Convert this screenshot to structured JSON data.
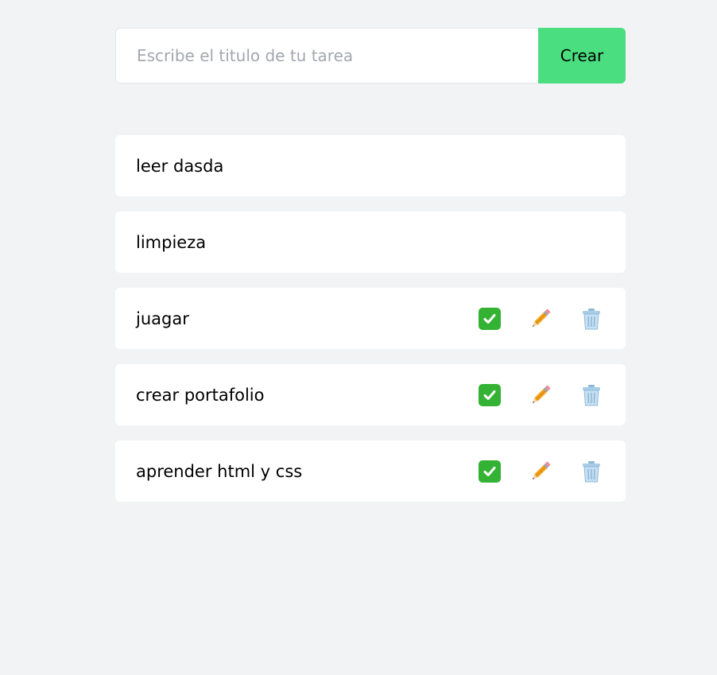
{
  "form": {
    "input_value": "",
    "input_placeholder": "Escribe el titulo de tu tarea",
    "create_label": "Crear"
  },
  "colors": {
    "background": "#f1f3f5",
    "create_button": "#4ade80",
    "card": "#ffffff",
    "check": "#34b233"
  },
  "tasks": [
    {
      "title": "leer dasda",
      "show_actions": false
    },
    {
      "title": "limpieza",
      "show_actions": false
    },
    {
      "title": "juagar",
      "show_actions": true
    },
    {
      "title": "crear portafolio",
      "show_actions": true
    },
    {
      "title": "aprender html y css",
      "show_actions": true
    }
  ],
  "icons": {
    "complete": "check-mark-button-icon",
    "edit": "pencil-icon",
    "delete": "trash-can-icon"
  }
}
